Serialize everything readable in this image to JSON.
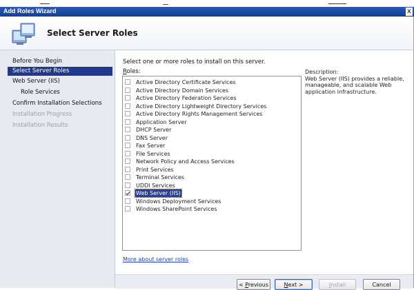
{
  "window": {
    "title": "Add Roles Wizard",
    "close_glyph": "x"
  },
  "header": {
    "icon": "server-roles-icon",
    "title": "Select Server Roles"
  },
  "nav": {
    "items": [
      {
        "label": "Before You Begin",
        "state": "normal"
      },
      {
        "label": "Select Server Roles",
        "state": "active"
      },
      {
        "label": "Web Server (IIS)",
        "state": "normal"
      },
      {
        "label": "Role Services",
        "state": "sub"
      },
      {
        "label": "Confirm Installation Selections",
        "state": "normal"
      },
      {
        "label": "Installation Progress",
        "state": "disabled"
      },
      {
        "label": "Installation Results",
        "state": "disabled"
      }
    ]
  },
  "content": {
    "intro": "Select one or more roles to install on this server.",
    "roles_label_first": "R",
    "roles_label_rest": "oles:",
    "roles": [
      {
        "name": "Active Directory Certificate Services",
        "checked": false,
        "selected": false
      },
      {
        "name": "Active Directory Domain Services",
        "checked": false,
        "selected": false
      },
      {
        "name": "Active Directory Federation Services",
        "checked": false,
        "selected": false
      },
      {
        "name": "Active Directory Lightweight Directory Services",
        "checked": false,
        "selected": false
      },
      {
        "name": "Active Directory Rights Management Services",
        "checked": false,
        "selected": false
      },
      {
        "name": "Application Server",
        "checked": false,
        "selected": false
      },
      {
        "name": "DHCP Server",
        "checked": false,
        "selected": false
      },
      {
        "name": "DNS Server",
        "checked": false,
        "selected": false
      },
      {
        "name": "Fax Server",
        "checked": false,
        "selected": false
      },
      {
        "name": "File Services",
        "checked": false,
        "selected": false
      },
      {
        "name": "Network Policy and Access Services",
        "checked": false,
        "selected": false
      },
      {
        "name": "Print Services",
        "checked": false,
        "selected": false
      },
      {
        "name": "Terminal Services",
        "checked": false,
        "selected": false
      },
      {
        "name": "UDDI Services",
        "checked": false,
        "selected": false
      },
      {
        "name": "Web Server (IIS)",
        "checked": true,
        "selected": true
      },
      {
        "name": "Windows Deployment Services",
        "checked": false,
        "selected": false
      },
      {
        "name": "Windows SharePoint Services",
        "checked": false,
        "selected": false
      }
    ],
    "description_heading": "Description:",
    "description": "Web Server (IIS) provides a reliable, manageable, and scalable Web application infrastructure.",
    "more_link": "More about server roles"
  },
  "footer": {
    "previous_pre": "< ",
    "previous_ul": "P",
    "previous_rest": "revious",
    "next_ul": "N",
    "next_rest": "ext >",
    "install_ul": "I",
    "install_rest": "nstall",
    "cancel": "Cancel"
  }
}
